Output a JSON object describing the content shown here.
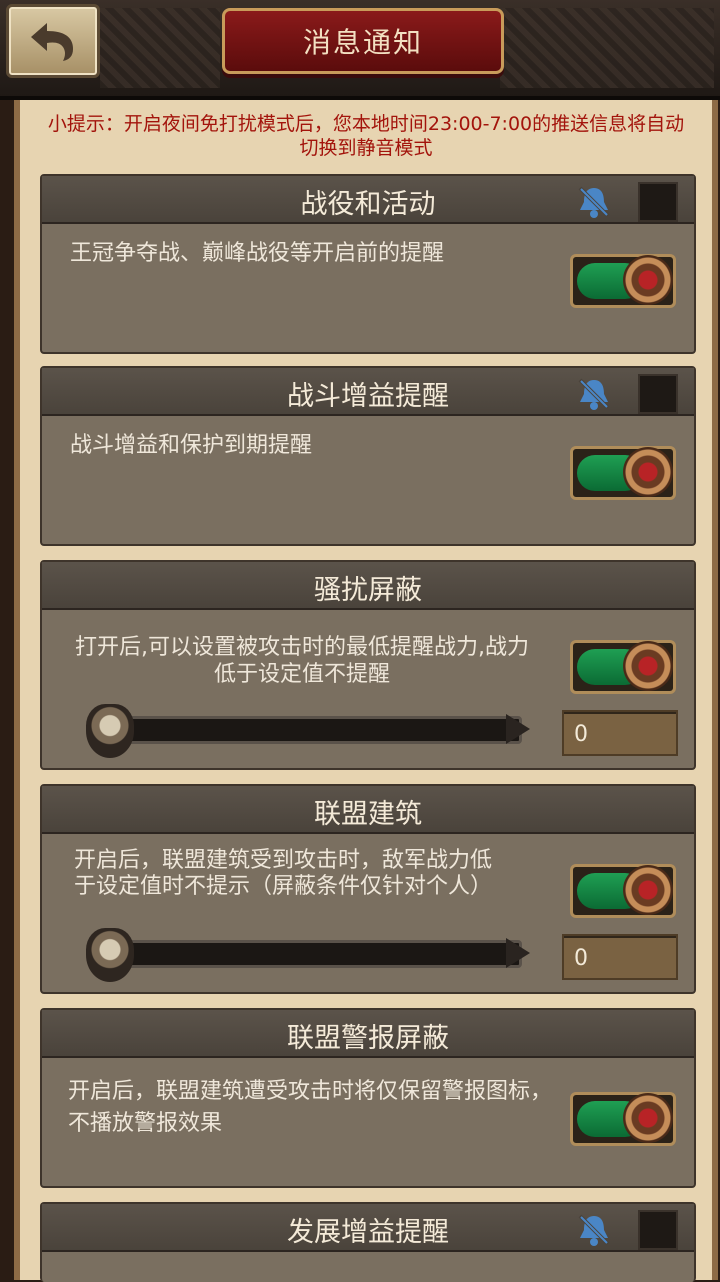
{
  "header": {
    "title": "消息通知",
    "back_icon": "back-arrow-icon"
  },
  "tip": "小提示：开启夜间免打扰模式后，您本地时间23:00-7:00的推送信息将自动切换到静音模式",
  "sections": [
    {
      "title": "战役和活动",
      "description": "王冠争夺战、巅峰战役等开启前的提醒",
      "toggle_on": true,
      "mute_icon": "bell-muted-icon",
      "mute_checked": false
    },
    {
      "title": "战斗增益提醒",
      "description": "战斗增益和保护到期提醒",
      "toggle_on": true,
      "mute_icon": "bell-muted-icon",
      "mute_checked": false
    },
    {
      "title": "骚扰屏蔽",
      "description": "打开后,可以设置被攻击时的最低提醒战力,战力低于设定值不提醒",
      "toggle_on": true,
      "slider_value": "0"
    },
    {
      "title": "联盟建筑",
      "description": "开启后，联盟建筑受到攻击时，敌军战力低于设定值时不提示（屏蔽条件仅针对个人）",
      "toggle_on": true,
      "slider_value": "0"
    },
    {
      "title": "联盟警报屏蔽",
      "description": "开启后，联盟建筑遭受攻击时将仅保留警报图标，不播放警报效果",
      "toggle_on": true
    },
    {
      "title": "发展增益提醒",
      "mute_icon": "bell-muted-icon",
      "mute_checked": false
    }
  ],
  "colors": {
    "accent_red": "#a3140c",
    "toggle_green": "#1f9f53",
    "panel": "#7a6f60",
    "parchment": "#e7d4b1"
  }
}
